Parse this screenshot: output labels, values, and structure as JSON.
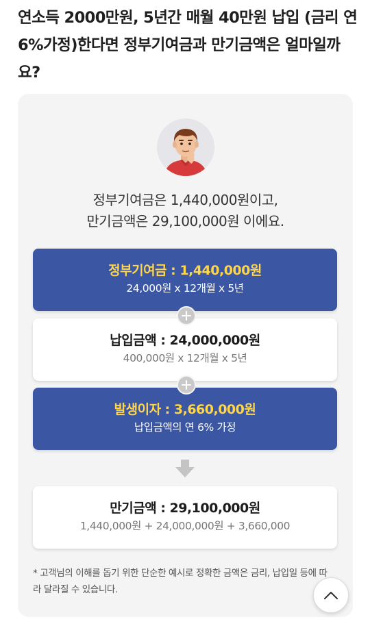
{
  "question": "연소득 2000만원, 5년간 매월 40만원 납입 (금리 연 6%가정)한다면 정부기여금과 만기금액은 얼마일까요?",
  "intro": {
    "line1": "정부기여금은 1,440,000원이고,",
    "line2": "만기금액은 29,100,000원 이에요."
  },
  "boxes": [
    {
      "title": "정부기여금 : 1,440,000원",
      "sub": "24,000원 x 12개월 x 5년"
    },
    {
      "title": "납입금액 : 24,000,000원",
      "sub": "400,000원 x 12개월 x 5년"
    },
    {
      "title": "발생이자 : 3,660,000원",
      "sub": "납입금액의 연 6% 가정"
    },
    {
      "title": "만기금액 : 29,100,000원",
      "sub": "1,440,000원 + 24,000,000원 + 3,660,000"
    }
  ],
  "note": "* 고객님의 이해를 돕기 위한 단순한 예시로 정확한 금액은 금리, 납입일 등에 따라 달라질 수 있습니다.",
  "icons": {
    "avatar": "person-thinking-avatar",
    "plus": "plus-circle-icon",
    "arrow": "arrow-down-icon",
    "scroll_top": "chevron-up-icon"
  },
  "colors": {
    "accent_blue": "#3b56a3",
    "highlight_yellow": "#ffd54a",
    "card_bg": "#f4f4f4"
  }
}
